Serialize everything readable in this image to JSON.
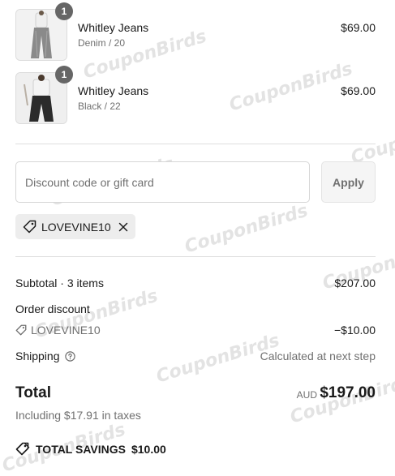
{
  "items": [
    {
      "quantity": "1",
      "name": "Whitley Jeans",
      "variant": "Denim / 20",
      "price": "$69.00",
      "image_icon": "jeans-product-image"
    },
    {
      "quantity": "1",
      "name": "Whitley Jeans",
      "variant": "Black / 22",
      "price": "$69.00",
      "image_icon": "jeans-product-image"
    }
  ],
  "discount": {
    "placeholder": "Discount code or gift card",
    "apply_label": "Apply",
    "applied_code": "LOVEVINE10",
    "tag_icon": "tag-icon",
    "remove_icon": "close-icon"
  },
  "summary": {
    "subtotal_label": "Subtotal · 3 items",
    "subtotal_value": "$207.00",
    "order_discount_label": "Order discount",
    "discount_code": "LOVEVINE10",
    "discount_value": "−$10.00",
    "shipping_label": "Shipping",
    "shipping_info_icon": "help-circle-icon",
    "shipping_value": "Calculated at next step",
    "total_label": "Total",
    "currency": "AUD",
    "total_value": "$197.00",
    "taxes_note": "Including $17.91 in taxes",
    "savings_label": "TOTAL SAVINGS",
    "savings_value": "$10.00"
  },
  "watermark": "CouponBirds",
  "colors": {
    "text": "#1a1a1a",
    "muted": "#707070",
    "divider": "#dedede",
    "chip": "#ededed",
    "badge": "#666666"
  }
}
